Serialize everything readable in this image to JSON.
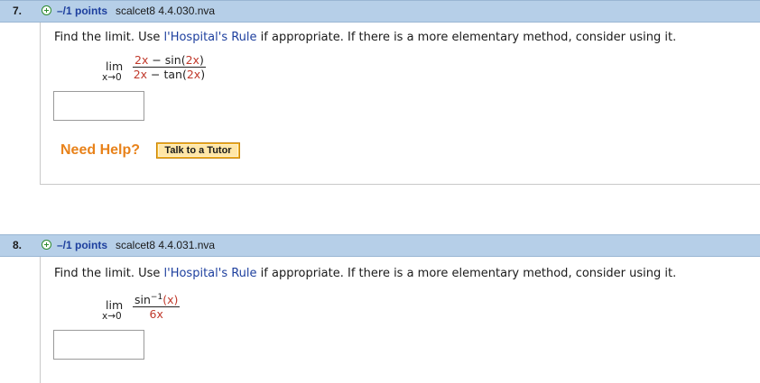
{
  "questions": [
    {
      "number": "7.",
      "points": "–/1 points",
      "code": "scalcet8 4.4.030.nva",
      "prompt_pre": "Find the limit. Use ",
      "prompt_link": "l'Hospital's Rule",
      "prompt_post": " if appropriate. If there is a more elementary method, consider using it.",
      "lim": "lim",
      "sub": "x→0",
      "numerator": [
        "2x",
        " − sin(",
        "2x",
        ")"
      ],
      "denominator": [
        "2x",
        " − tan(",
        "2x",
        ")"
      ],
      "answer_value": "",
      "need_help": "Need Help?",
      "tutor_button": "Talk to a Tutor"
    },
    {
      "number": "8.",
      "points": "–/1 points",
      "code": "scalcet8 4.4.031.nva",
      "prompt_pre": "Find the limit. Use ",
      "prompt_link": "l'Hospital's Rule",
      "prompt_post": " if appropriate. If there is a more elementary method, consider using it.",
      "lim": "lim",
      "sub": "x→0",
      "numerator_base": "sin",
      "numerator_sup": "−1",
      "numerator_arg": "(x)",
      "denominator": "6x",
      "answer_value": ""
    }
  ],
  "colors": {
    "header_bg": "#b6cfe8",
    "points_blue": "#1d3f9e",
    "math_red": "#c0392b",
    "need_help_orange": "#e8821a",
    "tutor_gold": "#f2b42a"
  },
  "icons": {
    "expand": "plus-circle-icon"
  }
}
